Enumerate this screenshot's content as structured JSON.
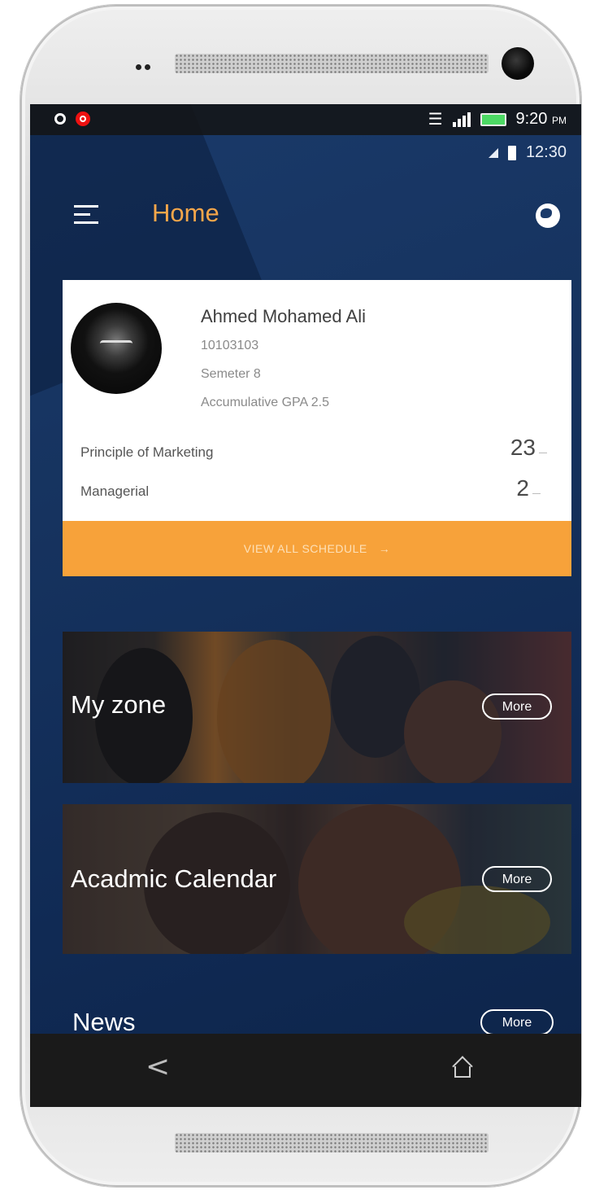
{
  "device": {
    "status_bar": {
      "time": "9:20",
      "time_suffix": "PM"
    },
    "secondary_status": {
      "time": "12:30"
    }
  },
  "app_bar": {
    "title": "Home"
  },
  "profile": {
    "name": "Ahmed Mohamed Ali",
    "id": "10103103",
    "semester": "Semeter 8",
    "gpa": "Accumulative GPA 2.5"
  },
  "schedule": {
    "items": [
      {
        "course": "Principle of Marketing",
        "value": "23",
        "unit": "—"
      },
      {
        "course": "Managerial",
        "value": "2",
        "unit": "—"
      }
    ],
    "view_all_label": "VIEW ALL SCHEDULE",
    "arrow": "→"
  },
  "tiles": [
    {
      "label": "My zone",
      "more_label": "More"
    },
    {
      "label": "Acadmic Calendar",
      "more_label": "More"
    }
  ],
  "news": {
    "label": "News",
    "more_label": "More"
  },
  "navigation": {
    "back_icon": "<",
    "home_icon": "home"
  }
}
